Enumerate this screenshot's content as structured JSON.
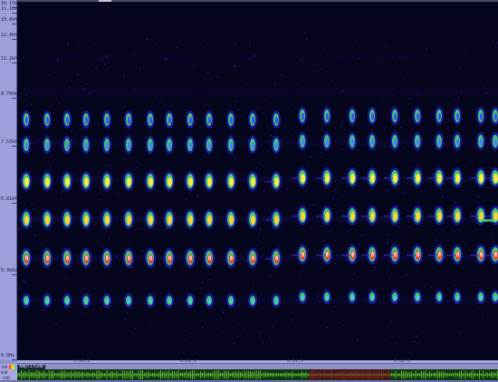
{
  "frequency_axis": {
    "labels": [
      "10.15kHz",
      "11.12kHz",
      "10.4kHz",
      "12.4kHz",
      "11.2kHz",
      "8.709kHz",
      "7.53kHz",
      "6.81kHz",
      "5.3kHz",
      "0.0Hz"
    ]
  },
  "time_axis": {
    "labels": [
      "0:00.5",
      "0:01.0",
      "0:01.5",
      "0:02.0"
    ]
  },
  "amplitude_panel": {
    "title": "Amplitude",
    "labels": [
      "160",
      "0dB",
      "-6dB"
    ]
  },
  "colors": {
    "background": "#05051e",
    "ruler": "#9d9fdc",
    "waveform_bg": "#0e3a0e",
    "waveform_line": "#9aff5a",
    "selection": "#c0303a"
  },
  "spectrogram": {
    "call_count": 24,
    "description_icons": "spectrogram-colormap"
  }
}
